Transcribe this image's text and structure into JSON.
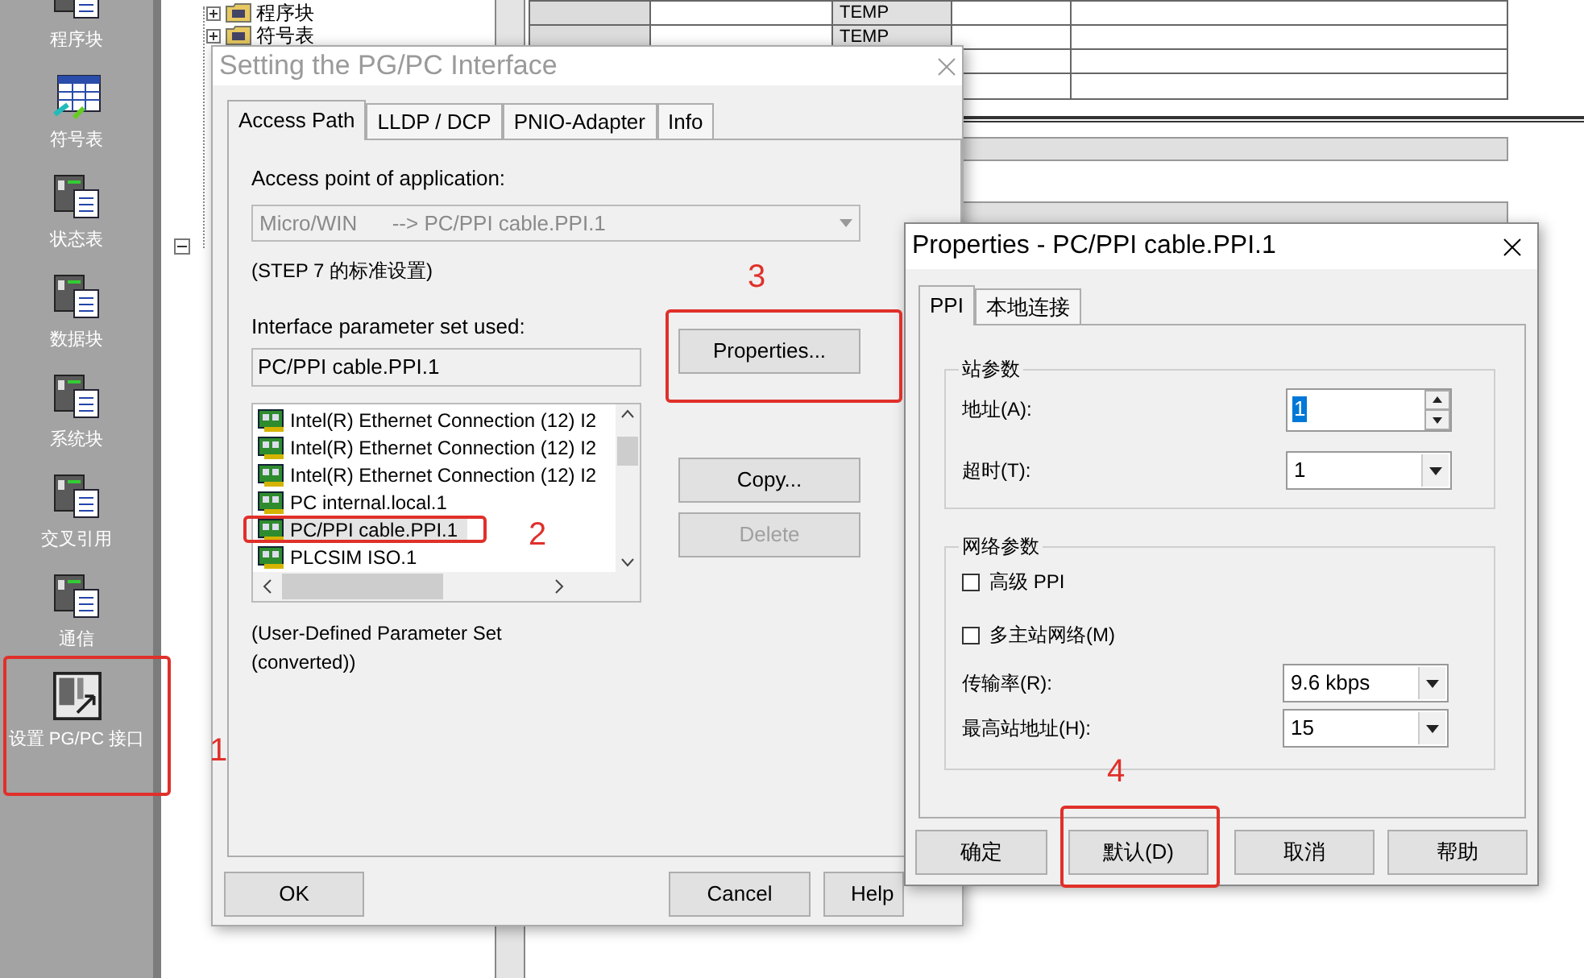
{
  "sidebar": {
    "items": [
      {
        "label": "程序块"
      },
      {
        "label": "符号表"
      },
      {
        "label": "状态表"
      },
      {
        "label": "数据块"
      },
      {
        "label": "系统块"
      },
      {
        "label": "交叉引用"
      },
      {
        "label": "通信"
      },
      {
        "label": "设置 PG/PC 接口"
      }
    ]
  },
  "tree": {
    "items": [
      {
        "label": "程序块",
        "expanded": false
      },
      {
        "label": "符号表",
        "expanded": false
      }
    ]
  },
  "table": {
    "rows": [
      {
        "column_3": "TEMP"
      },
      {
        "column_3": "TEMP"
      }
    ]
  },
  "pg_pc_dialog": {
    "title": "Setting the PG/PC Interface",
    "active": false,
    "tabs": [
      {
        "label": "Access Path",
        "selected": true
      },
      {
        "label": "LLDP / DCP",
        "selected": false
      },
      {
        "label": "PNIO-Adapter",
        "selected": false
      },
      {
        "label": "Info",
        "selected": false
      }
    ],
    "access_point_label": "Access point of application:",
    "access_point": {
      "value": "Micro/WIN      --> PC/PPI cable.PPI.1",
      "disabled": true
    },
    "access_point_note": "(STEP 7 的标准设置)",
    "parameter_set_label": "Interface parameter set used:",
    "parameter_set_field": {
      "value": "PC/PPI cable.PPI.1"
    },
    "parameter_sets": [
      {
        "label": "Intel(R) Ethernet Connection (12) I2",
        "selected": false
      },
      {
        "label": "Intel(R) Ethernet Connection (12) I2",
        "selected": false
      },
      {
        "label": "Intel(R) Ethernet Connection (12) I2",
        "selected": false
      },
      {
        "label": "PC internal.local.1",
        "selected": false
      },
      {
        "label": "PC/PPI cable.PPI.1",
        "selected": true
      },
      {
        "label": "PLCSIM ISO.1",
        "selected": false
      }
    ],
    "description": "(User-Defined Parameter Set\n(converted))",
    "side_buttons": [
      {
        "label": "Properties...",
        "disabled": false
      },
      {
        "label": "Copy...",
        "disabled": false
      },
      {
        "label": "Delete",
        "disabled": true
      }
    ],
    "buttons": [
      {
        "label": "OK"
      },
      {
        "label": "Cancel"
      },
      {
        "label": "Help"
      }
    ]
  },
  "properties_dialog": {
    "title": "Properties - PC/PPI cable.PPI.1",
    "tabs": [
      {
        "label": "PPI",
        "selected": true
      },
      {
        "label": "本地连接",
        "selected": false
      }
    ],
    "station_group": {
      "title": "站参数",
      "fields": [
        {
          "kind": "spinner",
          "label": "地址(A):",
          "value": "1",
          "highlighted": true
        },
        {
          "kind": "dropdown",
          "label": "超时(T):",
          "value": "1",
          "highlighted": false
        }
      ]
    },
    "network_group": {
      "title": "网络参数",
      "options": [
        {
          "label": "高级 PPI",
          "checked": false
        },
        {
          "label": "多主站网络(M)",
          "checked": false
        }
      ],
      "fields": [
        {
          "kind": "dropdown",
          "label": "传输率(R):",
          "value": "9.6 kbps",
          "highlighted": false
        },
        {
          "kind": "dropdown",
          "label": "最高站地址(H):",
          "value": "15",
          "highlighted": false
        }
      ]
    },
    "buttons": [
      {
        "label": "确定"
      },
      {
        "label": "默认(D)"
      },
      {
        "label": "取消"
      },
      {
        "label": "帮助"
      }
    ]
  },
  "annotations": [
    {
      "number": "1"
    },
    {
      "number": "2"
    },
    {
      "number": "3"
    },
    {
      "number": "4"
    }
  ]
}
